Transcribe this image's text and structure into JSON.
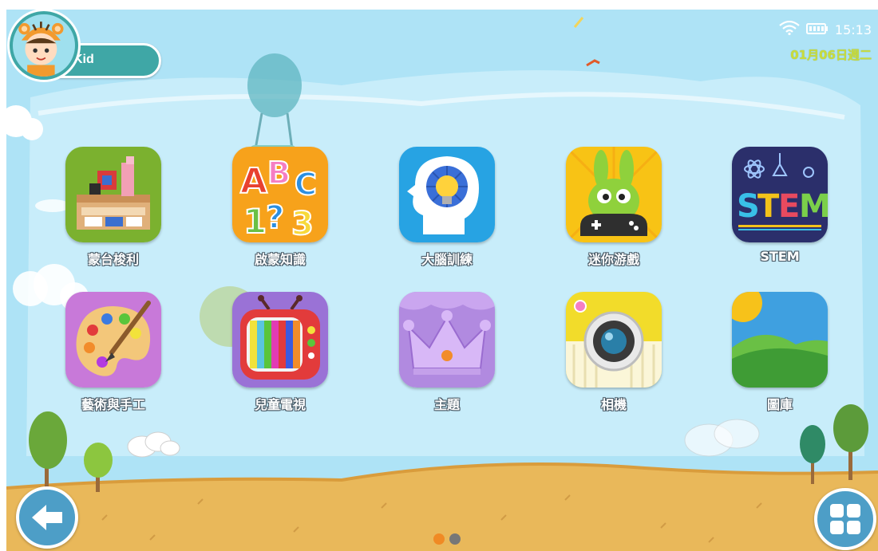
{
  "profile": {
    "name": "Kid",
    "avatar_icon": "tiger-kid-avatar-icon"
  },
  "status_bar": {
    "time": "15:13",
    "date": "01月06日週二",
    "wifi_icon": "wifi-icon",
    "battery_icon": "battery-icon"
  },
  "apps": [
    {
      "label": "蒙台梭利",
      "icon": "montessori-blocks-icon",
      "bg": "#7bb12f"
    },
    {
      "label": "啟蒙知識",
      "icon": "abc-123-icon",
      "bg": "#f7a21b"
    },
    {
      "label": "大腦訓練",
      "icon": "brain-lightbulb-icon",
      "bg": "#27a3e3"
    },
    {
      "label": "迷你游戲",
      "icon": "bunny-gamepad-icon",
      "bg": "#f8c315"
    },
    {
      "label": "STEM",
      "icon": "stem-science-icon",
      "bg": "#2b2f6b"
    },
    {
      "label": "藝術與手工",
      "icon": "paint-palette-icon",
      "bg": "#c879d9"
    },
    {
      "label": "兒童電視",
      "icon": "retro-tv-icon",
      "bg": "#9a72d6"
    },
    {
      "label": "主題",
      "icon": "crown-icon",
      "bg": "#b18ae0"
    },
    {
      "label": "相機",
      "icon": "camera-icon",
      "bg": "#f2dc2a"
    },
    {
      "label": "圖庫",
      "icon": "gallery-landscape-icon",
      "bg": "#3fa0e0"
    }
  ],
  "pager": {
    "pages": 2,
    "current": 1,
    "active_color": "#f08a24",
    "inactive_color": "#777777"
  },
  "controls": {
    "back_icon": "arrow-left-icon",
    "all_apps_icon": "grid-apps-icon"
  },
  "colors": {
    "sky": "#aee3f6",
    "ground": "#e9b85a",
    "accent": "#3fa7a6",
    "date": "#c8dc3c"
  }
}
